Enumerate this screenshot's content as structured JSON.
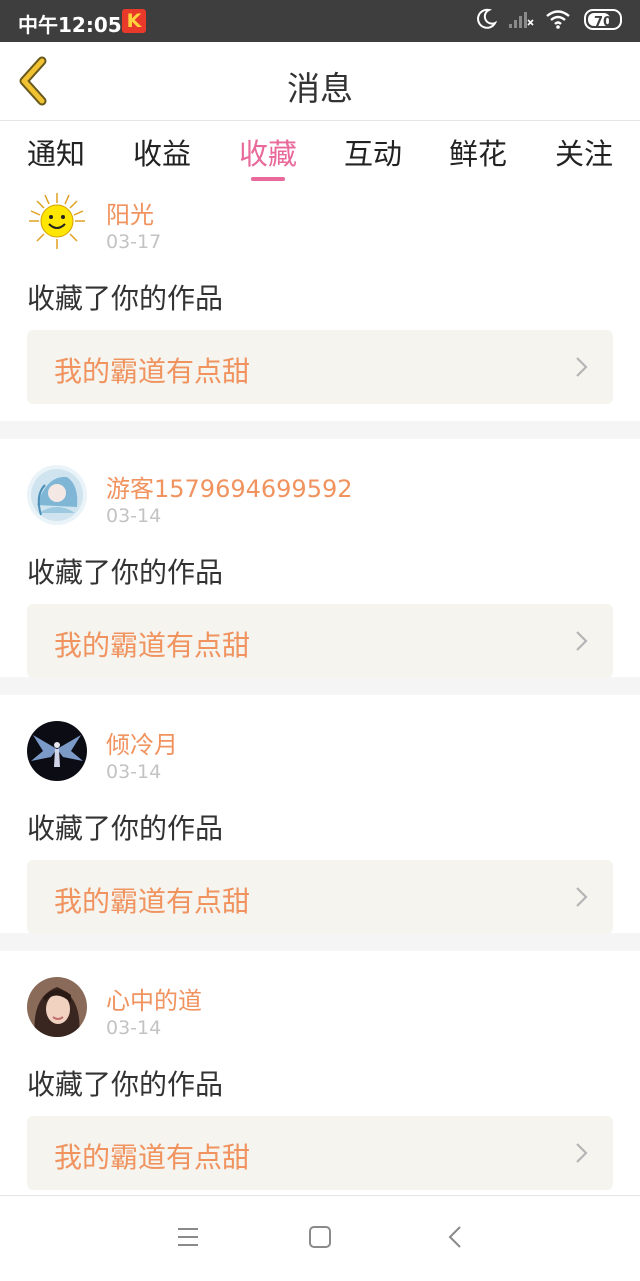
{
  "status_bar": {
    "time": "中午12:05",
    "app_icon_letter": "K",
    "icons": [
      "moon-icon",
      "signal-icon",
      "wifi-icon",
      "battery-icon"
    ],
    "battery_level": "70"
  },
  "header": {
    "title": "消息",
    "back_icon": "chevron-left-icon",
    "accent_color": "#e9a82a"
  },
  "tabs": [
    {
      "label": "通知"
    },
    {
      "label": "收益"
    },
    {
      "label": "收藏",
      "active": true
    },
    {
      "label": "互动"
    },
    {
      "label": "鲜花"
    },
    {
      "label": "关注"
    }
  ],
  "messages": [
    {
      "username": "阳光",
      "date": "03-17",
      "action": "收藏了你的作品",
      "work_title": "我的霸道有点甜",
      "avatar": "sun-avatar"
    },
    {
      "username": "游客1579694699592",
      "date": "03-14",
      "action": "收藏了你的作品",
      "work_title": "我的霸道有点甜",
      "avatar": "anime-girl-avatar"
    },
    {
      "username": "倾冷月",
      "date": "03-14",
      "action": "收藏了你的作品",
      "work_title": "我的霸道有点甜",
      "avatar": "angel-wings-avatar"
    },
    {
      "username": "心中的道",
      "date": "03-14",
      "action": "收藏了你的作品",
      "work_title": "我的霸道有点甜",
      "avatar": "portrait-avatar"
    }
  ],
  "nav_bar": {
    "buttons": [
      "menu-icon",
      "home-icon",
      "back-icon"
    ]
  },
  "colors": {
    "tab_active": "#e9699a",
    "username": "#f0935f",
    "work_box_bg": "#f5f4ef",
    "status_bar_bg": "#3e3e3e"
  }
}
